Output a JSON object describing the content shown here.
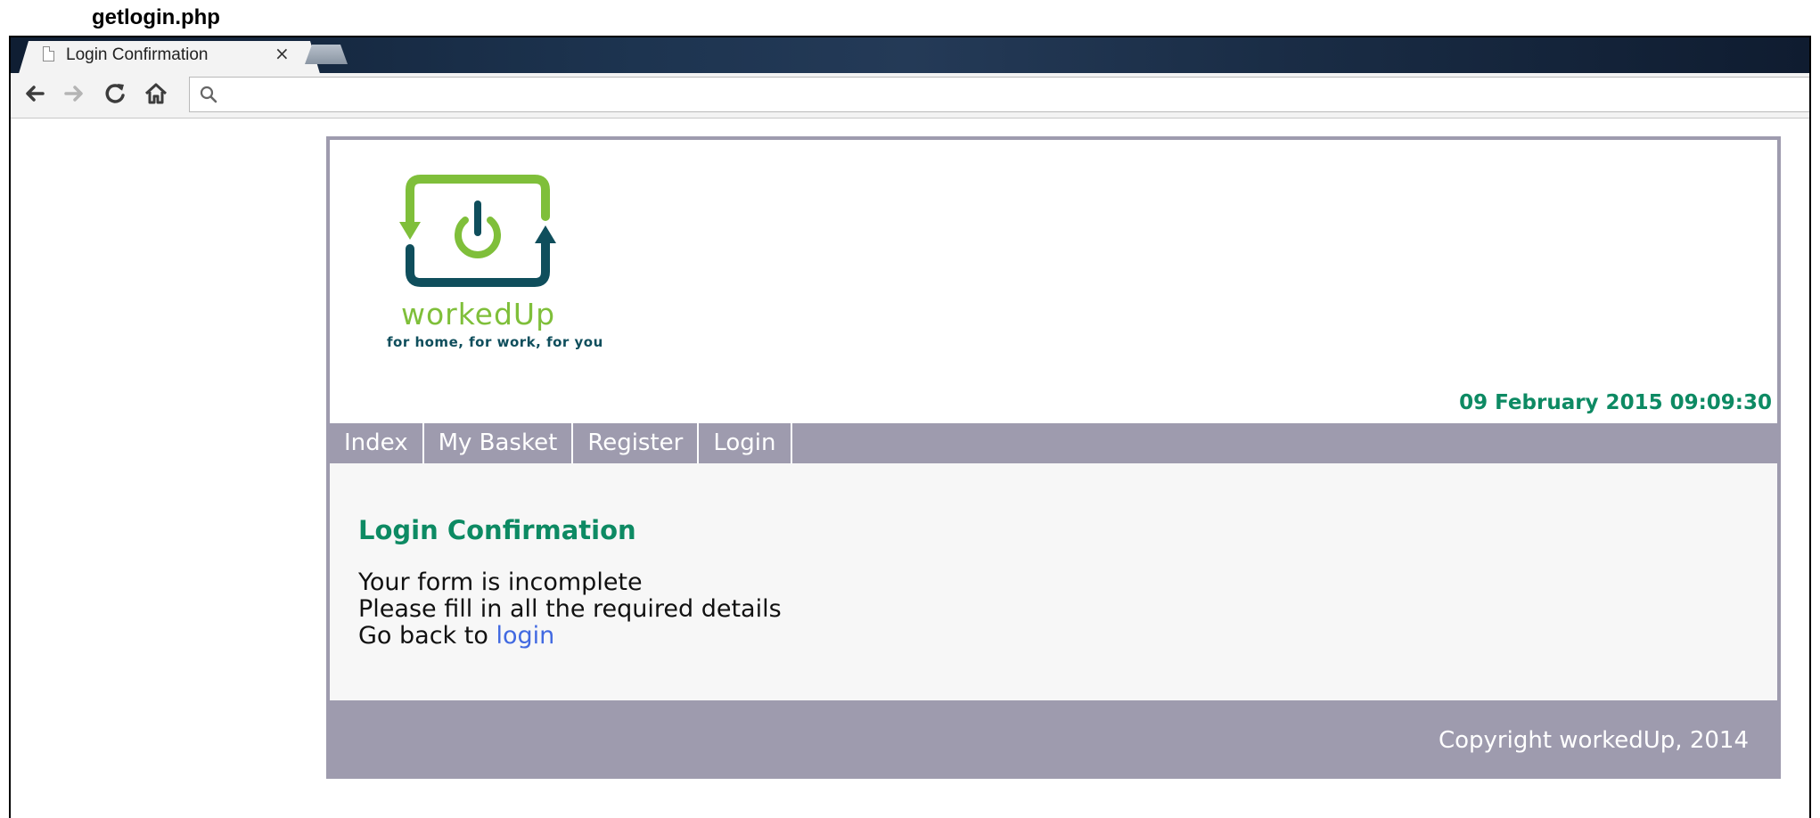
{
  "caption": "getlogin.php",
  "browser": {
    "tab_title": "Login Confirmation",
    "tab_close": "×",
    "address": ""
  },
  "site": {
    "logo": {
      "name": "workedUp",
      "tagline": "for home, for work, for you",
      "colors": {
        "green": "#7fbf3a",
        "teal": "#0f4e5c"
      }
    },
    "datetime": "09 February 2015 09:09:30",
    "nav": [
      "Index",
      "My Basket",
      "Register",
      "Login"
    ],
    "main": {
      "title": "Login Confirmation",
      "line1": "Your form is incomplete",
      "line2": "Please fill in all the required details",
      "line3_prefix": "Go back to ",
      "line3_link": "login"
    },
    "footer": "Copyright workedUp, 2014",
    "colors": {
      "accent": "#0d8a63",
      "bar": "#9e9bae",
      "link": "#4169e1"
    }
  }
}
